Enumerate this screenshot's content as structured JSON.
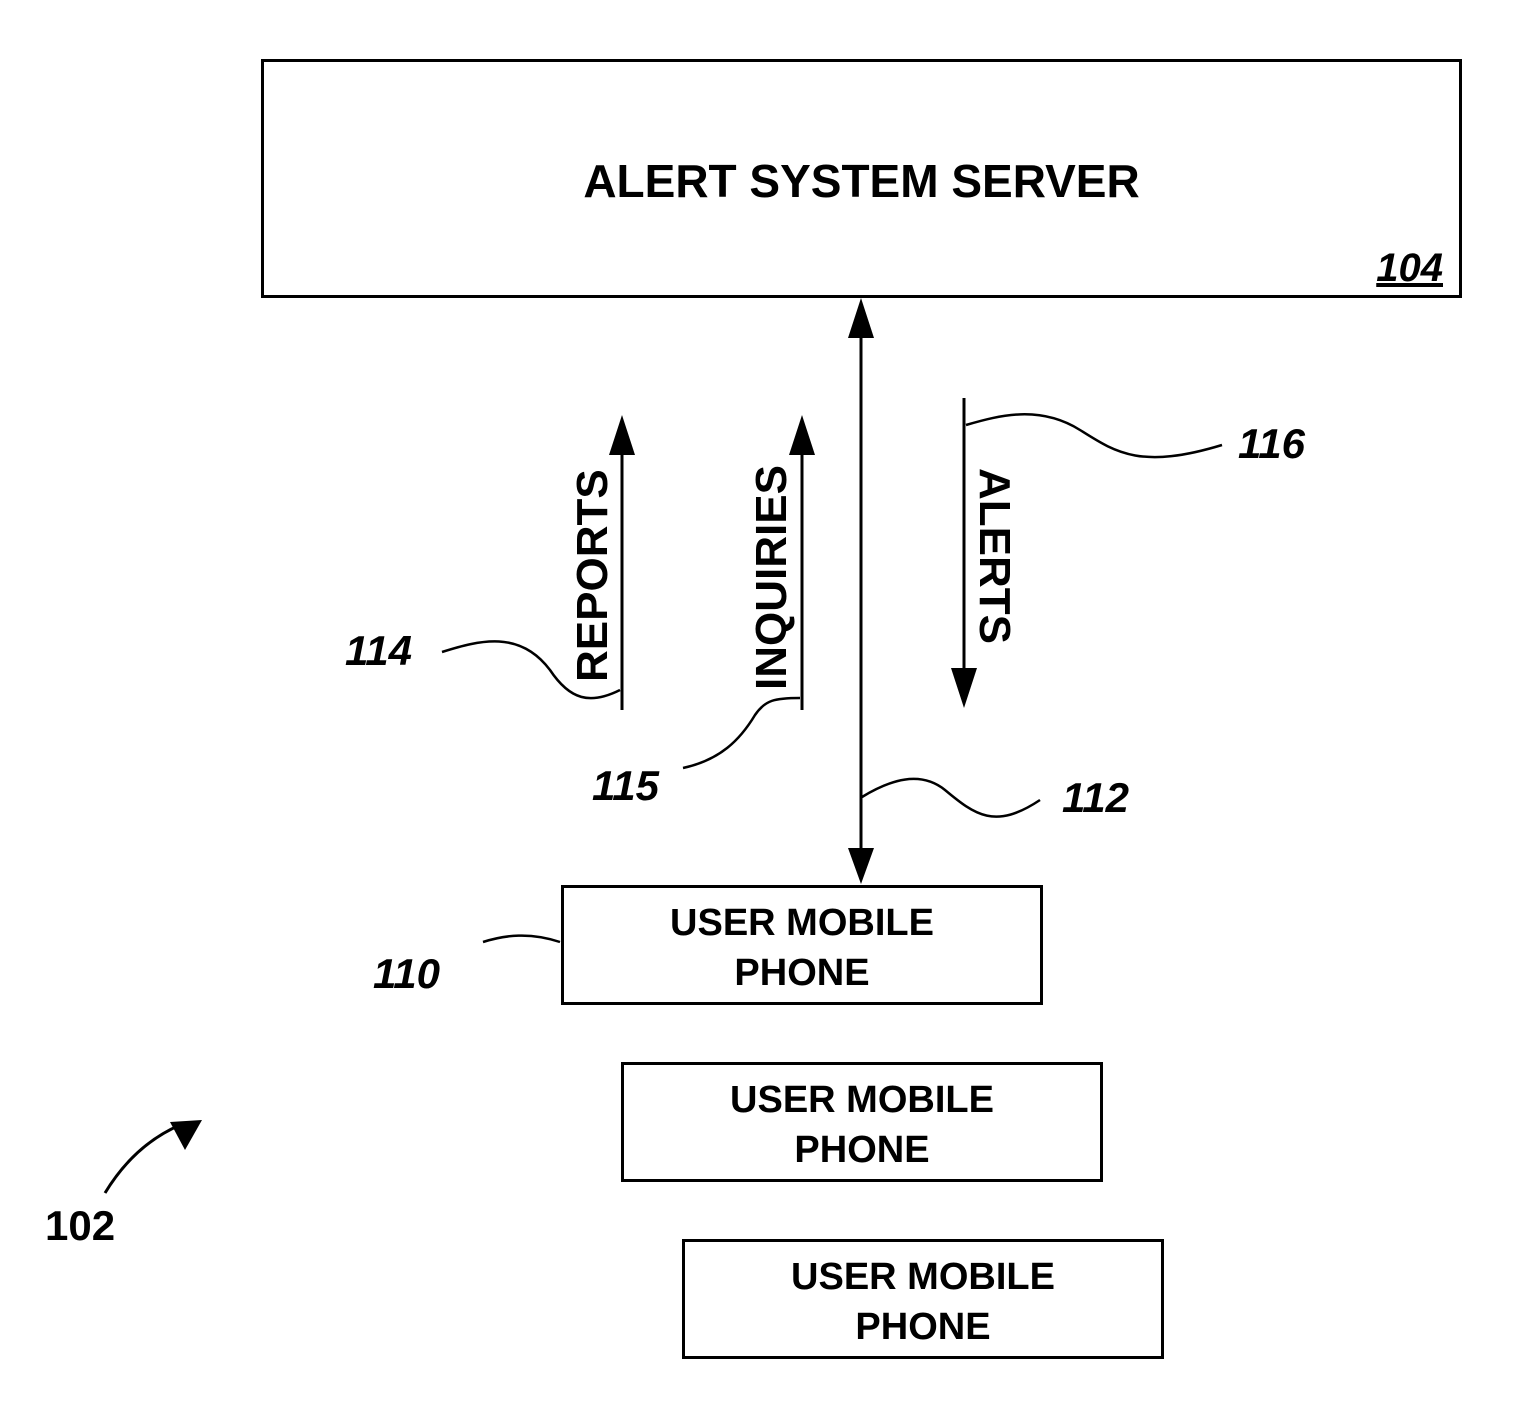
{
  "figure": {
    "id_label": "102",
    "server": {
      "title": "ALERT SYSTEM SERVER",
      "ref": "104"
    },
    "link": {
      "ref": "112"
    },
    "flows": [
      {
        "label": "REPORTS",
        "direction": "up",
        "ref": "114"
      },
      {
        "label": "INQUIRIES",
        "direction": "up",
        "ref": "115"
      },
      {
        "label": "ALERTS",
        "direction": "down",
        "ref": "116"
      }
    ],
    "phones": [
      {
        "line1": "USER MOBILE",
        "line2": "PHONE",
        "ref": "110"
      },
      {
        "line1": "USER MOBILE",
        "line2": "PHONE"
      },
      {
        "line1": "USER MOBILE",
        "line2": "PHONE"
      }
    ]
  }
}
